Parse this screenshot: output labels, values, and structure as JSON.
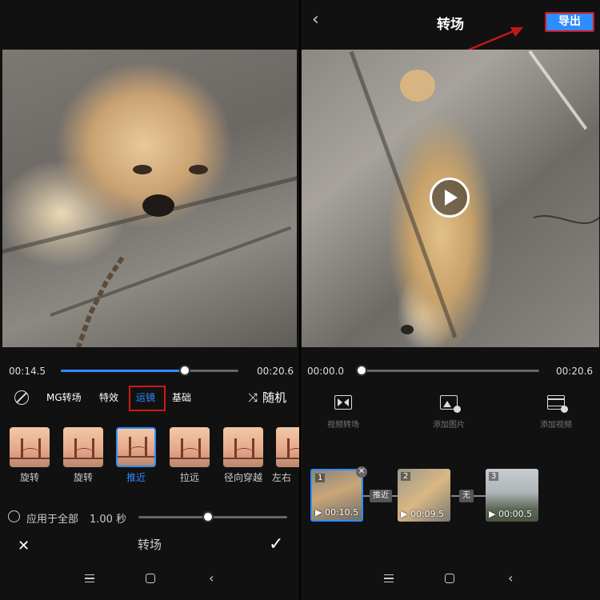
{
  "left": {
    "time_current": "00:14.5",
    "time_total": "00:20.6",
    "playback_progress": 0.7,
    "tabs": {
      "mg": "MG转场",
      "effects": "特效",
      "camera": "运镜",
      "basic": "基础"
    },
    "random_label": "随机",
    "presets": [
      "旋转",
      "旋转",
      "推近",
      "拉远",
      "径向穿越",
      "左右"
    ],
    "active_preset": 2,
    "apply_all_label": "应用于全部",
    "duration_label": "1.00 秒",
    "duration_progress": 0.47,
    "bottom_title": "转场"
  },
  "right": {
    "header_title": "转场",
    "export_label": "导出",
    "time_current": "00:00.0",
    "time_total": "00:20.6",
    "tools": [
      "视频转场",
      "添加图片",
      "添加视频"
    ],
    "clips": [
      {
        "index": "1",
        "duration": "00:10.5"
      },
      {
        "index": "2",
        "duration": "00:09.5"
      },
      {
        "index": "3",
        "duration": "00:00.5"
      }
    ],
    "transitions": [
      "推近",
      "无"
    ]
  },
  "colors": {
    "accent": "#2f8cff",
    "highlight_box": "#d01818",
    "annotation_arrow": "#c01818"
  },
  "icons": [
    "none-icon",
    "shuffle-icon",
    "close-icon",
    "check-icon",
    "back-icon",
    "play-icon",
    "transition-icon",
    "image-add-icon",
    "video-add-icon"
  ]
}
